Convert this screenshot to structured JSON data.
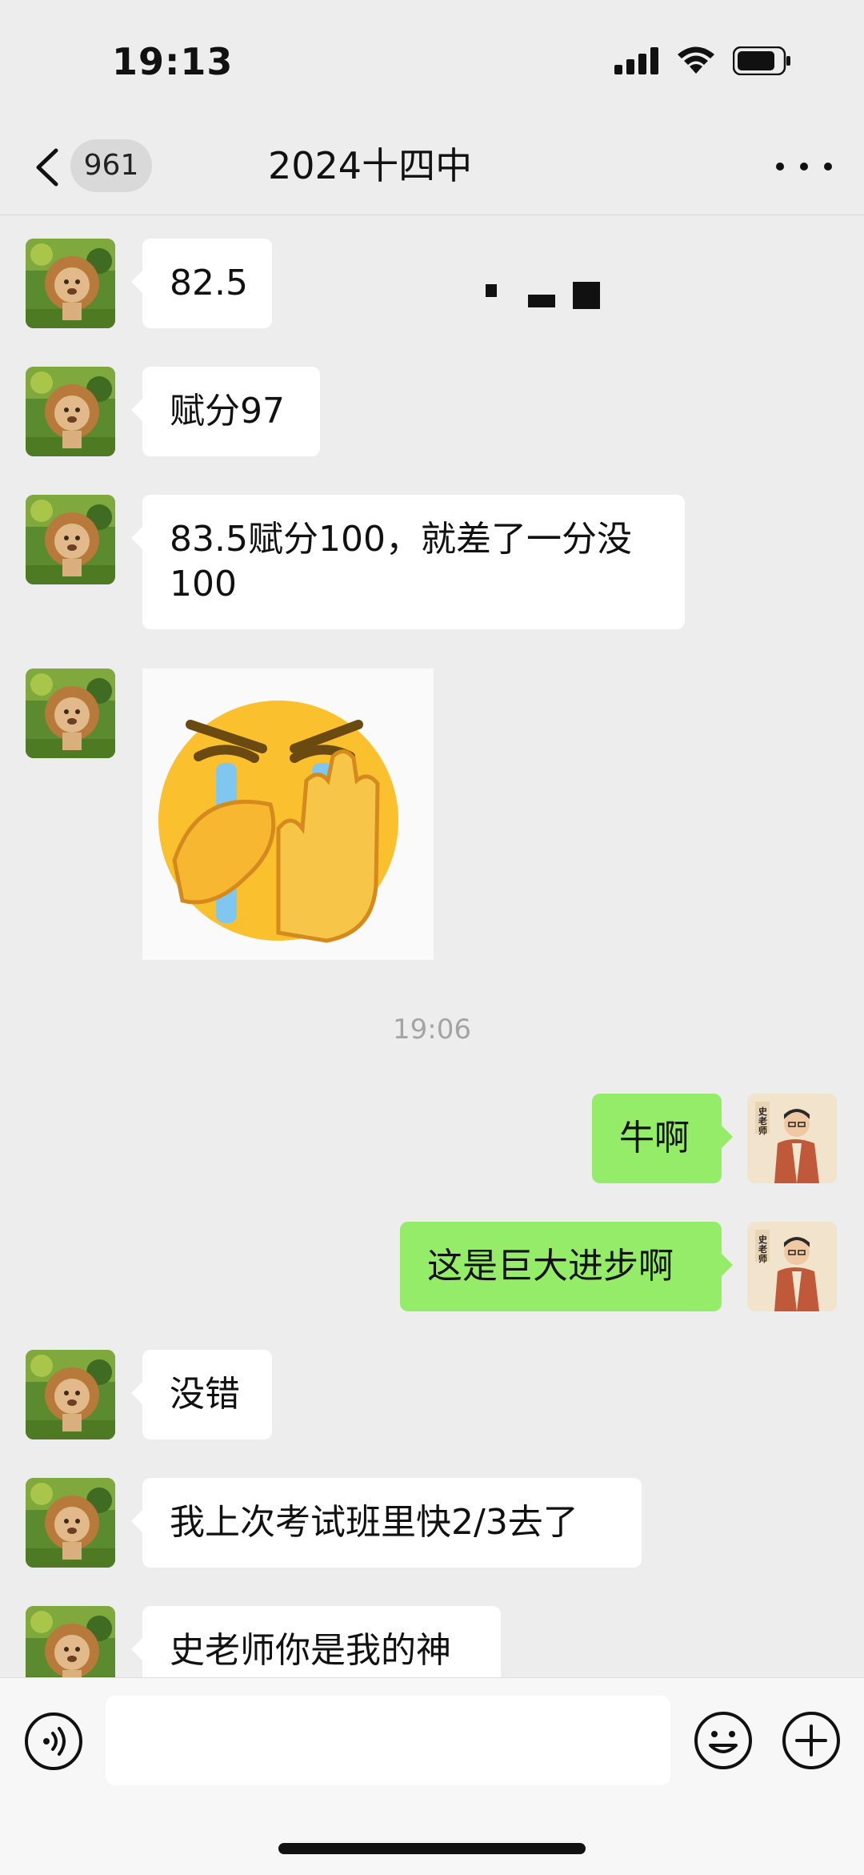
{
  "status_bar": {
    "time": "19:13"
  },
  "nav": {
    "unread_count": "961",
    "title": "2024十四中"
  },
  "messages": [
    {
      "side": "left",
      "text": "82.5"
    },
    {
      "side": "left",
      "text": "赋分97"
    },
    {
      "side": "left",
      "text": "83.5赋分100，就差了一分没100"
    },
    {
      "side": "left",
      "type": "sticker",
      "icon": "crying-hand-stop-emoji"
    },
    {
      "type": "timestamp",
      "text": "19:06"
    },
    {
      "side": "right",
      "text": "牛啊"
    },
    {
      "side": "right",
      "text": "这是巨大进步啊"
    },
    {
      "side": "left",
      "text": "没错"
    },
    {
      "side": "left",
      "text": "我上次考试班里快2/3去了"
    },
    {
      "side": "left",
      "text": "史老师你是我的神"
    }
  ],
  "avatars": {
    "left": "lion-avatar",
    "right": "teacher-illustration-avatar",
    "right_avatar_text": "史老师"
  },
  "input_bar": {
    "voice_icon": "voice-icon",
    "emoji_icon": "emoji-icon",
    "plus_icon": "plus-icon"
  },
  "colors": {
    "sent_bubble": "#95ec69",
    "received_bubble": "#ffffff",
    "background": "#ededed"
  }
}
